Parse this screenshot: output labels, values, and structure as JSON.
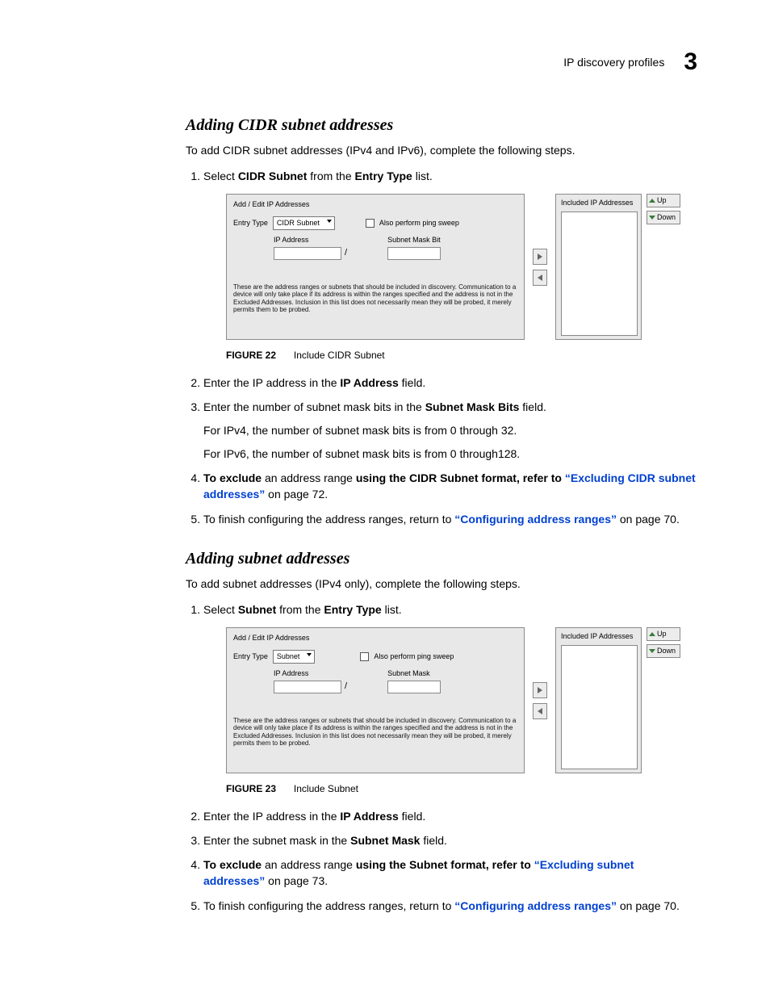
{
  "header": {
    "title": "IP discovery profiles",
    "chapter": "3"
  },
  "section1": {
    "heading": "Adding CIDR subnet addresses",
    "intro": "To add CIDR subnet addresses (IPv4 and IPv6), complete the following steps.",
    "step1_a": "Select ",
    "step1_b": "CIDR Subnet",
    "step1_c": " from the ",
    "step1_d": "Entry Type",
    "step1_e": " list.",
    "fig_label": "FIGURE 22",
    "fig_title": "Include CIDR Subnet",
    "step2_a": "Enter the IP address in the ",
    "step2_b": "IP Address",
    "step2_c": " field.",
    "step3_a": "Enter the number of subnet mask bits in the ",
    "step3_b": "Subnet Mask Bits",
    "step3_c": " field.",
    "step3_p1": "For IPv4, the number of subnet mask bits is from 0 through 32.",
    "step3_p2": "For IPv6, the number of subnet mask bits is from 0 through128.",
    "step4_a": "To exclude",
    "step4_b": " an address range ",
    "step4_c": "using the CIDR Subnet format, refer to ",
    "step4_link": "“Excluding CIDR subnet addresses”",
    "step4_d": " on page 72.",
    "step5_a": "To finish configuring the address ranges, return to ",
    "step5_link": "“Configuring address ranges”",
    "step5_b": " on page 70."
  },
  "section2": {
    "heading": "Adding subnet addresses",
    "intro": "To add subnet addresses (IPv4 only), complete the following steps.",
    "step1_a": "Select ",
    "step1_b": "Subnet",
    "step1_c": " from the ",
    "step1_d": "Entry Type",
    "step1_e": " list.",
    "fig_label": "FIGURE 23",
    "fig_title": "Include Subnet",
    "step2_a": "Enter the IP address in the ",
    "step2_b": "IP Address",
    "step2_c": " field.",
    "step3_a": "Enter the subnet mask in the ",
    "step3_b": "Subnet Mask",
    "step3_c": " field.",
    "step4_a": "To exclude",
    "step4_b": " an address range ",
    "step4_c": "using the Subnet format, refer to ",
    "step4_link": "“Excluding subnet addresses”",
    "step4_d": " on page 73.",
    "step5_a": "To finish configuring the address ranges, return to ",
    "step5_link": "“Configuring address ranges”",
    "step5_b": " on page 70."
  },
  "dialog1": {
    "left_title": "Add / Edit IP Addresses",
    "entry_label": "Entry Type",
    "entry_value": "CIDR Subnet",
    "ping_label": "Also perform ping sweep",
    "col1": "IP Address",
    "col2": "Subnet Mask Bit",
    "slash": "/",
    "desc": "These are the address ranges or subnets that should be included in discovery. Communication to a device will only take place if its address is within the ranges specified and the address is not in the Excluded Addresses. Inclusion in this list does not necessarily mean they will be probed, it merely permits them to be probed.",
    "right_title": "Included IP Addresses",
    "up": "Up",
    "down": "Down"
  },
  "dialog2": {
    "left_title": "Add / Edit IP Addresses",
    "entry_label": "Entry Type",
    "entry_value": "Subnet",
    "ping_label": "Also perform ping sweep",
    "col1": "IP Address",
    "col2": "Subnet Mask",
    "slash": "/",
    "desc": "These are the address ranges or subnets that should be included in discovery. Communication to a device will only take place if its address is within the ranges specified and the address is not in the Excluded Addresses. Inclusion in this list does not necessarily mean they will be probed, it merely permits them to be probed.",
    "right_title": "Included IP Addresses",
    "up": "Up",
    "down": "Down"
  }
}
